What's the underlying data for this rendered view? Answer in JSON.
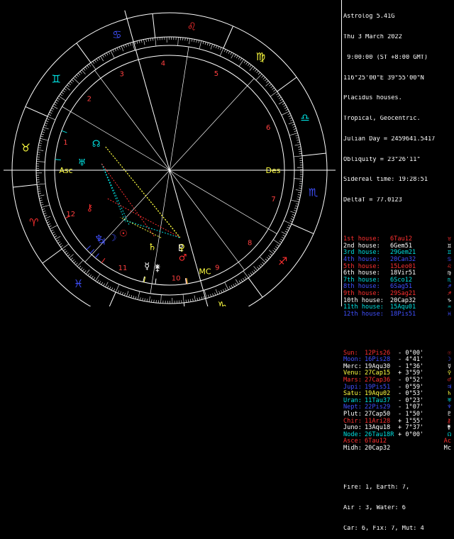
{
  "app_title": "Astrolog 5.41G",
  "chart_info": {
    "date": "Thu 3 March 2022",
    "time": " 9:00:00 (ST +8:00 GMT)",
    "location": "116°25'00\"E 39°55'00\"N",
    "house_system": "Placidus houses.",
    "zodiac": "Tropical, Geocentric.",
    "julian_day": "Julian Day = 2459641.5417",
    "obliquity": "Obliquity = 23°26'11\"",
    "sidereal": "Sidereal time: 19:28:51",
    "deltat": "DeltaT = 77.0123"
  },
  "houses": [
    {
      "label": "1st house:",
      "value": "6Tau12",
      "color": "#ff3030",
      "glyph": "♉"
    },
    {
      "label": "2nd house:",
      "value": "6Gem51",
      "color": "#ffffff",
      "glyph": "♊"
    },
    {
      "label": "3rd house:",
      "value": "29Gem21",
      "color": "#00e0e0",
      "glyph": "♊"
    },
    {
      "label": "4th house:",
      "value": "20Can32",
      "color": "#4050ff",
      "glyph": "♋"
    },
    {
      "label": "5th house:",
      "value": "15Leo01",
      "color": "#ff3030",
      "glyph": "♌"
    },
    {
      "label": "6th house:",
      "value": "18Vir51",
      "color": "#ffffff",
      "glyph": "♍"
    },
    {
      "label": "7th house:",
      "value": "6Sco12",
      "color": "#00e0e0",
      "glyph": "♏"
    },
    {
      "label": "8th house:",
      "value": "6Sag51",
      "color": "#4050ff",
      "glyph": "♐"
    },
    {
      "label": "9th house:",
      "value": "29Sag21",
      "color": "#ff3030",
      "glyph": "♐"
    },
    {
      "label": "10th house:",
      "value": "20Cap32",
      "color": "#ffffff",
      "glyph": "♑"
    },
    {
      "label": "11th house:",
      "value": "15Aqu01",
      "color": "#00e0e0",
      "glyph": "♒"
    },
    {
      "label": "12th house:",
      "value": "18Pis51",
      "color": "#4050ff",
      "glyph": "♓"
    }
  ],
  "planets": [
    {
      "name": "Sun:",
      "pos": "12Pis26",
      "lat": "- 0°00'",
      "color": "#ff3030",
      "glyph": "☉"
    },
    {
      "name": "Moon:",
      "pos": "16Pis28",
      "lat": "- 4°41'",
      "color": "#4050ff",
      "glyph": "☽"
    },
    {
      "name": "Merc:",
      "pos": "19Aqu30",
      "lat": "- 1°36'",
      "color": "#ffffff",
      "glyph": "☿"
    },
    {
      "name": "Venu:",
      "pos": "27Cap15",
      "lat": "+ 3°59'",
      "color": "#ffff40",
      "glyph": "♀"
    },
    {
      "name": "Mars:",
      "pos": "27Cap36",
      "lat": "- 0°52'",
      "color": "#ff3030",
      "glyph": "♂"
    },
    {
      "name": "Jupi:",
      "pos": "19Pis51",
      "lat": "- 0°59'",
      "color": "#4050ff",
      "glyph": "♃"
    },
    {
      "name": "Satu:",
      "pos": "19Aqu02",
      "lat": "- 0°53'",
      "color": "#ffff40",
      "glyph": "♄"
    },
    {
      "name": "Uran:",
      "pos": "11Tau37",
      "lat": "- 0°23'",
      "color": "#00e0e0",
      "glyph": "♅"
    },
    {
      "name": "Nept:",
      "pos": "22Pis29",
      "lat": "- 1°07'",
      "color": "#4050ff",
      "glyph": "♆"
    },
    {
      "name": "Plut:",
      "pos": "27Cap50",
      "lat": "- 1°50'",
      "color": "#ffffff",
      "glyph": "♇"
    },
    {
      "name": "Chir:",
      "pos": "11Ari28",
      "lat": "+ 1°55'",
      "color": "#ff3030",
      "glyph": "⚷"
    },
    {
      "name": "Juno:",
      "pos": "13Aqu18",
      "lat": "+ 7°37'",
      "color": "#ffffff",
      "glyph": "⚵"
    },
    {
      "name": "Node:",
      "pos": "26Tau18R",
      "lat": "+ 0°00'",
      "color": "#00e0e0",
      "glyph": "☊"
    },
    {
      "name": "Asce:",
      "pos": "6Tau12",
      "lat": "",
      "color": "#ff3030",
      "glyph": "Ac"
    },
    {
      "name": "Midh:",
      "pos": "20Cap32",
      "lat": "",
      "color": "#ffffff",
      "glyph": "Mc"
    }
  ],
  "elements": {
    "line1": "Fire: 1, Earth: 7,",
    "line2": "Air : 3, Water: 6",
    "line3": "Car: 6, Fix: 7, Mut: 4"
  },
  "wheel": {
    "house_numbers": [
      "1",
      "2",
      "3",
      "4",
      "5",
      "6",
      "7",
      "8",
      "9",
      "10",
      "11",
      "12"
    ],
    "asc_label": "Asc",
    "des_label": "Des",
    "mc_label": "MC",
    "colors": {
      "outer_ring": "#ffffff",
      "house_cusp": "#ffffff",
      "fire": "#ff3030",
      "earth": "#ffff40",
      "air": "#00e0e0",
      "water": "#4050ff"
    }
  }
}
